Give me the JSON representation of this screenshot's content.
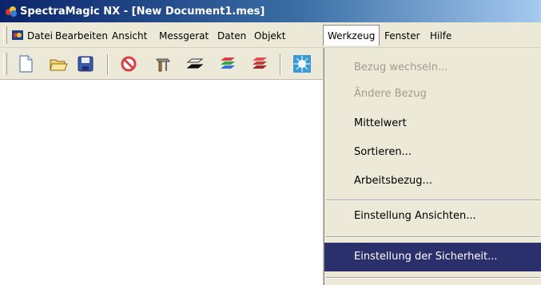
{
  "window": {
    "title": "SpectraMagic NX - [New Document1.mes]",
    "title_bar_color": "#0a246a"
  },
  "menubar": {
    "items": [
      {
        "label": "Datei",
        "mnemonic": "D"
      },
      {
        "label": "Bearbeiten",
        "mnemonic": "B"
      },
      {
        "label": "Ansicht",
        "mnemonic": "A"
      },
      {
        "label": "Messgerat",
        "mnemonic": "M"
      },
      {
        "label": "Daten",
        "mnemonic": "D"
      },
      {
        "label": "Objekt",
        "mnemonic": "O"
      },
      {
        "label": "Werkzeug",
        "mnemonic": "W",
        "active": true
      },
      {
        "label": "Fenster",
        "mnemonic": "F"
      },
      {
        "label": "Hilfe",
        "mnemonic": "H"
      }
    ]
  },
  "toolbar": {
    "buttons": [
      {
        "icon": "new-document-icon"
      },
      {
        "icon": "open-folder-icon"
      },
      {
        "icon": "save-icon"
      },
      {
        "icon": "no-entry-icon"
      },
      {
        "icon": "tool-icon"
      },
      {
        "icon": "black-layers-icon"
      },
      {
        "icon": "color-layers-icon"
      },
      {
        "icon": "red-layers-icon"
      },
      {
        "icon": "burst-icon"
      }
    ]
  },
  "dropdown": {
    "items": [
      {
        "label": "Bezug wechseln...",
        "disabled": true
      },
      {
        "label": "Ändere Bezug",
        "disabled": true
      },
      {
        "label": "Mittelwert",
        "disabled": false
      },
      {
        "label": "Sortieren...",
        "disabled": false
      },
      {
        "label": "Arbeitsbezug...",
        "disabled": false
      },
      {
        "label": "Einstellung Ansichten...",
        "disabled": false
      },
      {
        "label": "Einstellung der Sicherheit...",
        "disabled": false,
        "highlighted": true
      }
    ],
    "highlight_color": "#2b2f6b"
  }
}
